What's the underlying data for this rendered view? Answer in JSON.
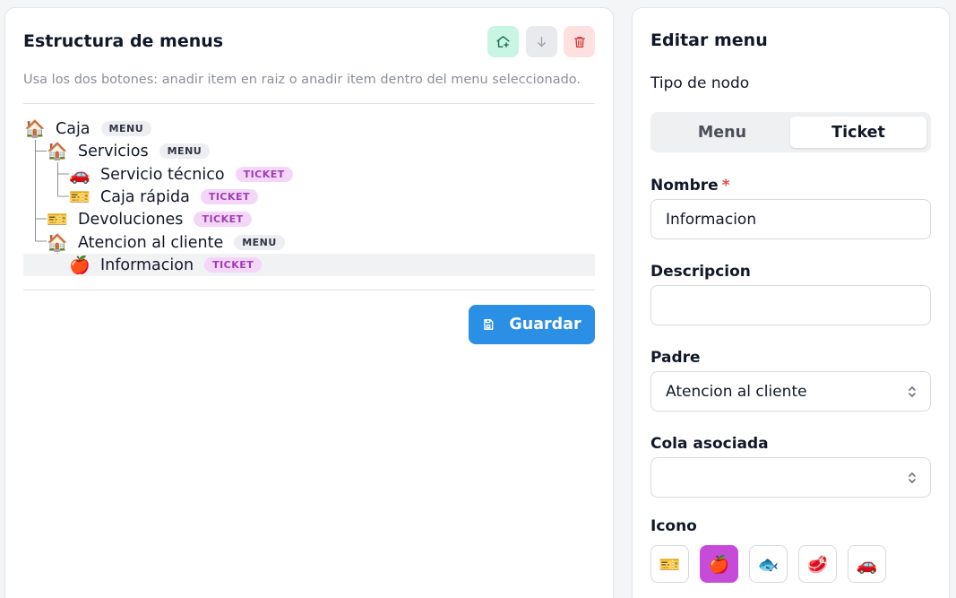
{
  "structure": {
    "title": "Estructura de menus",
    "hint": "Usa los dos botones: anadir item en raiz o anadir item dentro del menu seleccionado.",
    "tree": [
      {
        "icon": "🏠",
        "label": "Caja",
        "badge": "MENU",
        "kind": "menu",
        "depth": 0
      },
      {
        "icon": "🏠",
        "label": "Servicios",
        "badge": "MENU",
        "kind": "menu",
        "depth": 1
      },
      {
        "icon": "🚗",
        "label": "Servicio técnico",
        "badge": "TICKET",
        "kind": "ticket",
        "depth": 2
      },
      {
        "icon": "🎫",
        "label": "Caja rápida",
        "badge": "TICKET",
        "kind": "ticket",
        "depth": 2
      },
      {
        "icon": "🎫",
        "label": "Devoluciones",
        "badge": "TICKET",
        "kind": "ticket",
        "depth": 1
      },
      {
        "icon": "🏠",
        "label": "Atencion al cliente",
        "badge": "MENU",
        "kind": "menu",
        "depth": 1
      },
      {
        "icon": "🍎",
        "label": "Informacion",
        "badge": "TICKET",
        "kind": "ticket",
        "depth": 2,
        "selected": true
      }
    ],
    "save_label": "Guardar"
  },
  "editor": {
    "title": "Editar menu",
    "type_label": "Tipo de nodo",
    "type_options": [
      "Menu",
      "Ticket"
    ],
    "type_selected": "Ticket",
    "name_label": "Nombre",
    "name_required_mark": "*",
    "name_value": "Informacion",
    "description_label": "Descripcion",
    "description_value": "",
    "parent_label": "Padre",
    "parent_value": "Atencion al cliente",
    "queue_label": "Cola asociada",
    "queue_value": "",
    "icon_label": "Icono",
    "icon_options": [
      "🎫",
      "🍎",
      "🐟",
      "🥩",
      "🚗"
    ],
    "icon_selected": "🍎"
  },
  "colors": {
    "primary": "#2b8fe6",
    "ticket_badge_bg": "#f3d6f8",
    "ticket_badge_text": "#a03db5",
    "selected_icon_bg": "#c64bd8",
    "required": "#e5484d"
  }
}
